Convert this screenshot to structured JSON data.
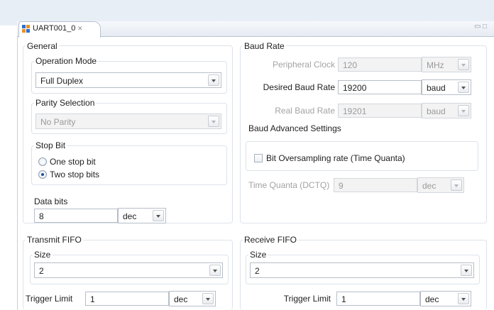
{
  "tab": {
    "title": "UART001_0",
    "close_glyph": "✕"
  },
  "window_controls": {
    "minimize": "▭",
    "maximize": "□"
  },
  "general": {
    "title": "General",
    "operation_mode": {
      "label": "Operation Mode",
      "value": "Full Duplex"
    },
    "parity": {
      "label": "Parity Selection",
      "value": "No Parity"
    },
    "stop_bit": {
      "label": "Stop Bit",
      "options": [
        "One stop bit",
        "Two stop bits"
      ],
      "selected": "Two stop bits"
    },
    "data_bits": {
      "label": "Data bits",
      "value": "8",
      "unit": "dec"
    }
  },
  "baud_rate": {
    "title": "Baud Rate",
    "peripheral_clock": {
      "label": "Peripheral Clock",
      "value": "120",
      "unit": "MHz"
    },
    "desired": {
      "label": "Desired Baud Rate",
      "value": "19200",
      "unit": "baud"
    },
    "real": {
      "label": "Real Baud Rate",
      "value": "19201",
      "unit": "baud"
    },
    "advanced": {
      "title": "Baud Advanced Settings",
      "oversampling_label": "Bit Oversampling rate (Time Quanta)",
      "oversampling_checked": false,
      "time_quanta": {
        "label": "Time Quanta (DCTQ)",
        "value": "9",
        "unit": "dec"
      }
    }
  },
  "transmit_fifo": {
    "title": "Transmit FIFO",
    "size_label": "Size",
    "size_value": "2",
    "trigger_label": "Trigger Limit",
    "trigger_value": "1",
    "trigger_unit": "dec"
  },
  "receive_fifo": {
    "title": "Receive FIFO",
    "size_label": "Size",
    "size_value": "2",
    "trigger_label": "Trigger Limit",
    "trigger_value": "1",
    "trigger_unit": "dec"
  },
  "colors": {
    "accent": "#1f4f9a",
    "icon_blue": "#2f6fd0",
    "icon_orange": "#e8912d"
  }
}
